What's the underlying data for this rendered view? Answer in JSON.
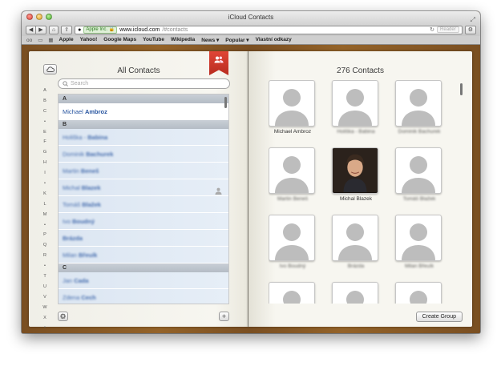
{
  "window": {
    "title": "iCloud Contacts"
  },
  "toolbar": {
    "back": "◀",
    "forward": "▶",
    "cert_label": "Apple Inc.",
    "url_host": "www.icloud.com",
    "url_path": "/#contacts",
    "reader_label": "Reader"
  },
  "bookmarks": [
    "Apple",
    "Yahoo!",
    "Google Maps",
    "YouTube",
    "Wikipedia",
    "News ▾",
    "Popular ▾",
    "Vlastní odkazy"
  ],
  "left": {
    "title": "All Contacts",
    "search_placeholder": "Search",
    "alphabet": [
      "A",
      "B",
      "C",
      "•",
      "E",
      "F",
      "G",
      "H",
      "I",
      "•",
      "K",
      "L",
      "M",
      "•",
      "P",
      "Q",
      "R",
      "•",
      "T",
      "U",
      "V",
      "W",
      "X",
      "•",
      "Z",
      "#"
    ]
  },
  "list": {
    "sections": [
      {
        "letter": "A",
        "rows": [
          {
            "first": "Michael",
            "last": "Ambroz",
            "blurred": false
          }
        ]
      },
      {
        "letter": "B",
        "rows": [
          {
            "first": "Holiška -",
            "last": "Babina",
            "blurred": true
          },
          {
            "first": "Dominik",
            "last": "Bachurek",
            "blurred": true
          },
          {
            "first": "Martin",
            "last": "Beneš",
            "blurred": true
          },
          {
            "first": "Michal",
            "last": "Blazek",
            "blurred": true,
            "me": true
          },
          {
            "first": "Tomáš",
            "last": "Blažek",
            "blurred": true
          },
          {
            "first": "Ivo",
            "last": "Boudný",
            "blurred": true
          },
          {
            "first": "",
            "last": "Brázda",
            "blurred": true
          },
          {
            "first": "Milan",
            "last": "Břeuík",
            "blurred": true
          }
        ]
      },
      {
        "letter": "C",
        "rows": [
          {
            "first": "Jan",
            "last": "Cada",
            "blurred": true
          },
          {
            "first": "Zdena",
            "last": "Cech",
            "blurred": true
          }
        ]
      }
    ]
  },
  "right": {
    "title": "276 Contacts",
    "create_group": "Create Group",
    "cards": [
      {
        "name": "Michael Ambroz",
        "blurred": false,
        "photo": false
      },
      {
        "name": "Holiška - Babina",
        "blurred": true,
        "photo": false
      },
      {
        "name": "Dominik Bachurek",
        "blurred": true,
        "photo": false
      },
      {
        "name": "Martin Beneš",
        "blurred": true,
        "photo": false
      },
      {
        "name": "Michal Blazek",
        "blurred": false,
        "photo": true
      },
      {
        "name": "Tomáš Blažek",
        "blurred": true,
        "photo": false
      },
      {
        "name": "Ivo Boudný",
        "blurred": true,
        "photo": false
      },
      {
        "name": "Brázda",
        "blurred": true,
        "photo": false
      },
      {
        "name": "Milan Břeuík",
        "blurred": true,
        "photo": false
      },
      {
        "name": "",
        "blurred": true,
        "photo": false
      },
      {
        "name": "",
        "blurred": true,
        "photo": false
      },
      {
        "name": "",
        "blurred": true,
        "photo": false
      }
    ]
  },
  "colors": {
    "accent": "#2855a0",
    "ribbon": "#d13b2d",
    "book": "#8a5a26"
  }
}
